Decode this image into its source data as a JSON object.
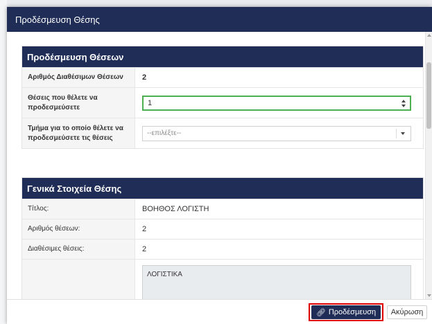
{
  "modal": {
    "title": "Προδέσμευση Θέσης"
  },
  "reserve_panel": {
    "heading": "Προδέσμευση Θέσεων",
    "available_label": "Αριθμός Διαθέσιμων Θέσεων",
    "available_value": "2",
    "positions_label": "Θέσεις που θέλετε να προδεσμεύσετε",
    "positions_value": "1",
    "department_label": "Τμήμα για το οποίο θέλετε να προδεσμεύσετε τις θέσεις",
    "department_value": "--επιλέξτε--"
  },
  "general_panel": {
    "heading": "Γενικά Στοιχεία Θέσης",
    "title_label": "Τίτλος:",
    "title_value": "ΒΟΗΘΟΣ ΛΟΓΙΣΤΗ",
    "positions_label": "Αριθμός θέσεων:",
    "positions_value": "2",
    "available_label": "Διαθέσιμες θέσεις:",
    "available_value": "2",
    "description_value": "ΛΟΓΙΣΤΙΚΑ"
  },
  "footer": {
    "reserve_button": "Προδέσμευση",
    "cancel_button": "Ακύρωση"
  },
  "colors": {
    "header_bg": "#1f2d57",
    "focus_border": "#4caf50",
    "highlight": "#e00000"
  }
}
